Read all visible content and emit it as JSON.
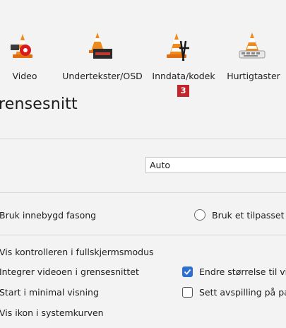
{
  "toolbar": {
    "items": [
      {
        "label": "Video",
        "icon": "vlc-cone-video-icon"
      },
      {
        "label": "Undertekster/OSD",
        "icon": "vlc-cone-subtitles-icon"
      },
      {
        "label": "Inndata/kodek",
        "icon": "vlc-cone-input-codec-icon"
      },
      {
        "label": "Hurtigtaster",
        "icon": "vlc-cone-hotkeys-icon"
      }
    ],
    "badge": "3"
  },
  "section": {
    "title": "rensesnitt"
  },
  "dropdown": {
    "value": "Auto"
  },
  "style": {
    "native_label": "Bruk innebygd fasong",
    "custom_label": "Bruk et tilpasset t"
  },
  "options": {
    "fullscreen_controller": "Vis kontrolleren i fullskjermsmodus",
    "integrate_video": "Integrer videoen i grensesnittet",
    "minimal_view": "Start i minimal visning",
    "systray_icon": "Vis ikon i systemkurven",
    "resize_label": "Endre størrelse til vi",
    "resize_checked": true,
    "pause_label": "Sett avspilling på pa",
    "pause_checked": false
  },
  "colors": {
    "accent": "#2f6fcf",
    "badge": "#c2252c",
    "cone_orange": "#f08a1c"
  }
}
